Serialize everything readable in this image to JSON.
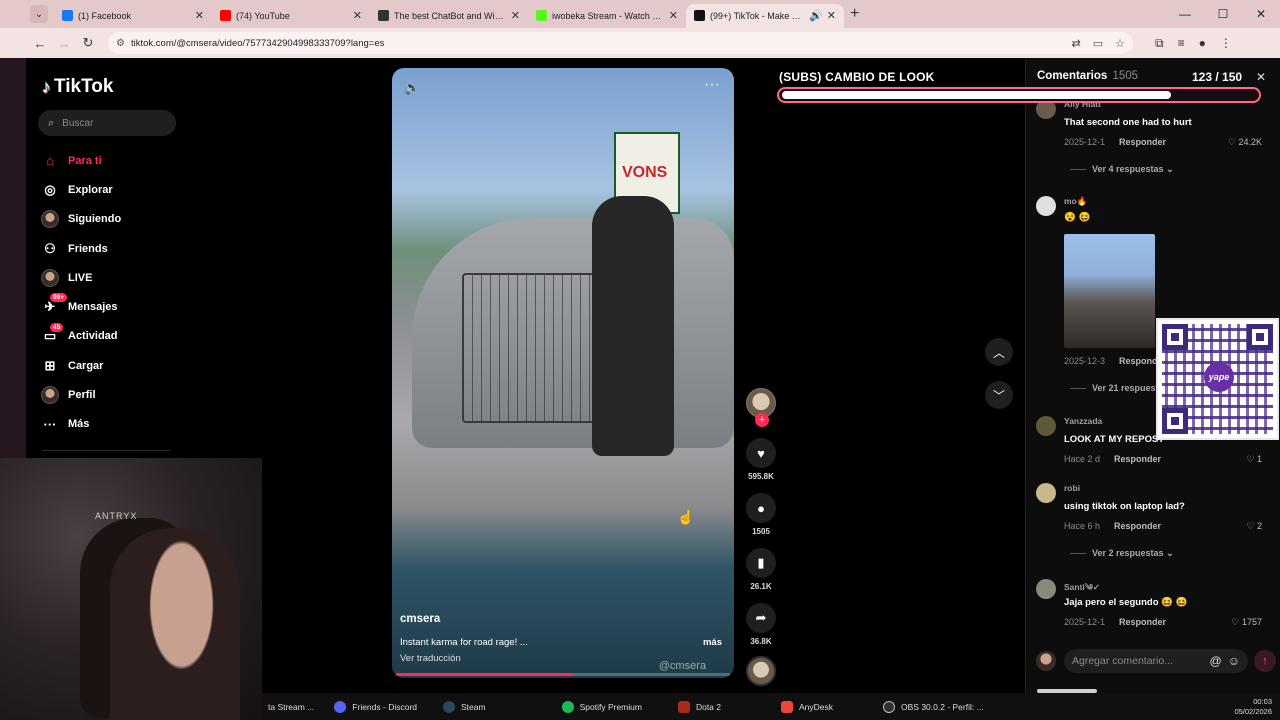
{
  "browser": {
    "tabs": [
      {
        "label": "(1) Facebook",
        "icon": "facebook-icon",
        "color": "#1877f2"
      },
      {
        "label": "(74) YouTube",
        "icon": "youtube-icon",
        "color": "#ff0000"
      },
      {
        "label": "The best ChatBot and Widgets",
        "icon": "chatbot-icon",
        "color": "#333333"
      },
      {
        "label": "iwobeka Stream - Watch Live o",
        "icon": "kick-icon",
        "color": "#53fc18"
      },
      {
        "label": "(99+) TikTok - Make Your Da",
        "icon": "tiktok-icon",
        "color": "#111111",
        "active": true
      }
    ],
    "url": "tiktok.com/@cmsera/video/7577342904998333709?lang=es"
  },
  "sidebar": {
    "brand": "TikTok",
    "search_placeholder": "Buscar",
    "items": [
      {
        "label": "Para ti",
        "icon": "home-icon",
        "active": true
      },
      {
        "label": "Explorar",
        "icon": "compass-icon"
      },
      {
        "label": "Siguiendo",
        "icon": "following-avatar-icon"
      },
      {
        "label": "Friends",
        "icon": "friends-icon"
      },
      {
        "label": "LIVE",
        "icon": "live-icon"
      },
      {
        "label": "Mensajes",
        "icon": "messages-icon",
        "badge": "99+"
      },
      {
        "label": "Actividad",
        "icon": "activity-icon",
        "badge": "45"
      },
      {
        "label": "Cargar",
        "icon": "upload-icon"
      },
      {
        "label": "Perfil",
        "icon": "profile-icon"
      },
      {
        "label": "Más",
        "icon": "more-icon"
      }
    ]
  },
  "webcam": {
    "brand": "ANTRYX"
  },
  "video": {
    "author": "cmsera",
    "caption": "Instant karma for road rage! ...",
    "more_label": "más",
    "translate_label": "Ver traducción",
    "watermark": "@cmsera",
    "progress_percent": 53,
    "sign_text": "VONS"
  },
  "actions": {
    "likes": "595.8K",
    "comments": "1505",
    "saves": "26.1K",
    "shares": "36.8K"
  },
  "overlay": {
    "subs_title": "(SUBS) CAMBIO DE LOOK",
    "subs_count": "123  / 150",
    "subs_progress": 0.82
  },
  "comments": {
    "title": "Comentarios",
    "count": "1505",
    "items": [
      {
        "user": "Ally Hiatt",
        "text": "That second one had to hurt",
        "date": "2025-12-1",
        "reply": "Responder",
        "likes": "24.2K",
        "replies": "Ver 4 respuestas"
      },
      {
        "user": "mo🔥",
        "text": "😵 😆",
        "date": "2025-12-3",
        "reply": "Responder",
        "likes": "",
        "replies": "Ver 21 respuestas"
      },
      {
        "user": "Yanzzada",
        "text": "LOOK AT MY REPOST",
        "date": "Hace 2 d",
        "reply": "Responder",
        "likes": "1",
        "replies": ""
      },
      {
        "user": "robi",
        "text": "using tiktok on laptop lad?",
        "date": "Hace 6 h",
        "reply": "Responder",
        "likes": "2",
        "replies": "Ver 2 respuestas"
      },
      {
        "user": "Santi༄✓",
        "text": "Jaja pero el segundo 😆 😆",
        "date": "2025-12-1",
        "reply": "Responder",
        "likes": "1757",
        "replies": ""
      }
    ],
    "input_placeholder": "Agregar comentario..."
  },
  "qr": {
    "logo_text": "yape"
  },
  "taskbar": {
    "items": [
      {
        "label": "ta Stream ...",
        "color": "#53fc18"
      },
      {
        "label": "Friends - Discord",
        "color": "#5865f2"
      },
      {
        "label": "Steam",
        "color": "#1b2838"
      },
      {
        "label": "Spotify Premium",
        "color": "#1db954"
      },
      {
        "label": "Dota 2",
        "color": "#a82b1e"
      },
      {
        "label": "AnyDesk",
        "color": "#ef443b"
      },
      {
        "label": "OBS 30.0.2 - Perfil: ...",
        "color": "#302e31"
      }
    ],
    "time": "00:03",
    "date": "05/02/2026"
  }
}
